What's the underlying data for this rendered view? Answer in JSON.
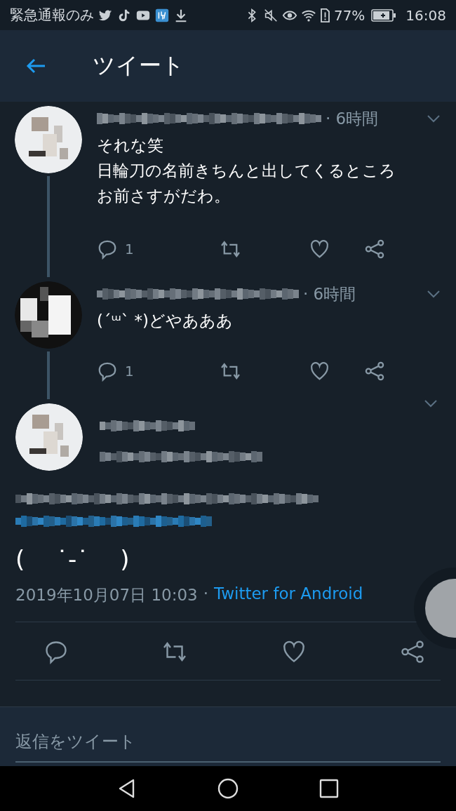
{
  "status_bar": {
    "carrier": "緊急通報のみ",
    "battery": "77%",
    "time": "16:08"
  },
  "header": {
    "title": "ツイート"
  },
  "replies": [
    {
      "time": "· 6時間",
      "text_lines": [
        "それな笑",
        "日輪刀の名前きちんと出してくるところ",
        "お前さすがだわ。"
      ],
      "reply_count": "1"
    },
    {
      "time": "· 6時間",
      "text_lines": [
        "(´ᵚ` *)どやあああ"
      ],
      "reply_count": "1"
    }
  ],
  "main_tweet": {
    "text": "(　 ˙-˙　 )",
    "timestamp": "2019年10月07日 10:03",
    "separator": "·",
    "source": "Twitter for Android"
  },
  "reply_box": {
    "placeholder": "返信をツイート"
  }
}
